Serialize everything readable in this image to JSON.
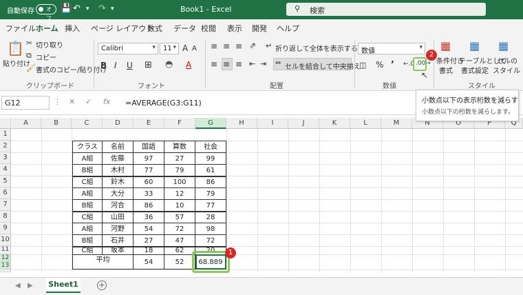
{
  "titlebar": {
    "autosave_label": "自動保存",
    "autosave_state": "オフ",
    "doc_title": "Book1 - Excel",
    "search_placeholder": "検索"
  },
  "menu": {
    "tabs": [
      "ファイル",
      "ホーム",
      "挿入",
      "ページ レイアウト",
      "数式",
      "データ",
      "校閲",
      "表示",
      "開発",
      "ヘルプ"
    ],
    "active": "ホーム"
  },
  "ribbon": {
    "clipboard": {
      "paste": "貼り付け",
      "cut": "切り取り",
      "copy": "コピー",
      "format_painter": "書式のコピー/貼り付け",
      "label": "クリップボード"
    },
    "font": {
      "font_name": "Calibri",
      "font_size": "11",
      "grow": "A",
      "shrink": "A",
      "bold": "B",
      "italic": "I",
      "underline": "U",
      "label": "フォント"
    },
    "alignment": {
      "wrap_text": "折り返して全体を表示する",
      "merge_center": "セルを結合して中央揃え",
      "label": "配置"
    },
    "number": {
      "format": "数値",
      "label": "数値"
    },
    "styles": {
      "conditional_line1": "条件付き",
      "conditional_line2": "書式",
      "table_line1": "テーブルとして",
      "table_line2": "書式設定",
      "cell_line1": "セルの",
      "cell_line2": "スタイル",
      "label": "スタイル"
    },
    "badge_2": "2"
  },
  "tooltip": {
    "title": "小数点以下の表示桁数を減らす",
    "description": "小数点以下の桁数を減らします。"
  },
  "formula_bar": {
    "name_box": "G12",
    "fx": "fx",
    "formula": "=AVERAGE(G3:G11)"
  },
  "grid": {
    "columns": [
      "A",
      "B",
      "C",
      "D",
      "E",
      "F",
      "G",
      "H",
      "I",
      "J",
      "K",
      "L",
      "M",
      "N",
      "O",
      "P",
      "Q"
    ],
    "selected_column": "G",
    "rows": [
      "1",
      "2",
      "3",
      "4",
      "5",
      "6",
      "7",
      "8",
      "9",
      "10",
      "11",
      "12",
      "13",
      "14"
    ],
    "selected_rows": [
      "12",
      "13"
    ],
    "headers": [
      "クラス",
      "名前",
      "国語",
      "算数",
      "社会"
    ],
    "data": [
      [
        "A組",
        "佐藤",
        "97",
        "27",
        "99"
      ],
      [
        "B組",
        "木村",
        "77",
        "79",
        "61"
      ],
      [
        "C組",
        "鈴木",
        "60",
        "100",
        "86"
      ],
      [
        "A組",
        "大分",
        "33",
        "12",
        "79"
      ],
      [
        "B組",
        "河合",
        "86",
        "10",
        "77"
      ],
      [
        "C組",
        "山田",
        "36",
        "57",
        "28"
      ],
      [
        "A組",
        "河野",
        "54",
        "72",
        "98"
      ],
      [
        "B組",
        "石井",
        "27",
        "47",
        "72"
      ],
      [
        "C組",
        "坂本",
        "18",
        "62",
        "20"
      ]
    ],
    "average_label": "平均",
    "averages": [
      "54",
      "52",
      "68.889"
    ],
    "badge_1": "1"
  },
  "sheets": {
    "tabs": [
      "Sheet1"
    ],
    "add": "+"
  }
}
